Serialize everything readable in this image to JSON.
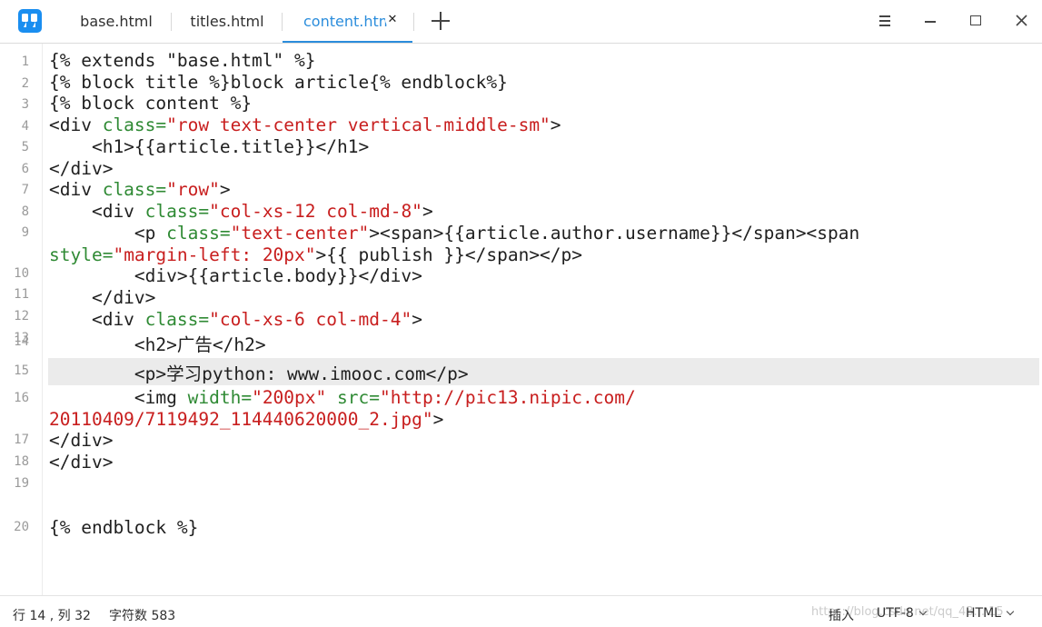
{
  "tabs": [
    {
      "label": "base.html",
      "active": false
    },
    {
      "label": "titles.html",
      "active": false
    },
    {
      "label": "content.html",
      "active": true
    }
  ],
  "icons": {
    "app": "quote-icon",
    "close_tab": "close-icon",
    "add_tab": "plus-icon",
    "menu": "hamburger-menu-icon",
    "minimize": "minimize-icon",
    "maximize": "maximize-icon",
    "close_window": "close-icon",
    "dropdown": "chevron-down-icon"
  },
  "colors": {
    "accent": "#2b8ddc",
    "line_highlight": "#ebebeb",
    "string": "#c81e1e",
    "attribute": "#2f8a34"
  },
  "editor": {
    "current_line": 14,
    "line_numbers": [
      "1",
      "2",
      "3",
      "4",
      "5",
      "6",
      "7",
      "8",
      "9",
      "10",
      "11",
      "12",
      "13",
      "14",
      "15",
      "16",
      "17",
      "18",
      "19",
      "20"
    ],
    "lines": [
      [
        {
          "t": "plain",
          "v": "{% extends \"base.html\" %}"
        }
      ],
      [
        {
          "t": "plain",
          "v": "{% block title %}block article{% endblock%}"
        }
      ],
      [
        {
          "t": "plain",
          "v": "{% block content %}"
        }
      ],
      [
        {
          "t": "tag",
          "v": "<div "
        },
        {
          "t": "attr",
          "v": "class="
        },
        {
          "t": "str",
          "v": "\"row text-center vertical-middle-sm\""
        },
        {
          "t": "tag",
          "v": ">"
        }
      ],
      [
        {
          "t": "plain",
          "v": "    <h1>{{article.title}}</h1>"
        }
      ],
      [
        {
          "t": "plain",
          "v": "</div>"
        }
      ],
      [
        {
          "t": "tag",
          "v": "<div "
        },
        {
          "t": "attr",
          "v": "class="
        },
        {
          "t": "str",
          "v": "\"row\""
        },
        {
          "t": "tag",
          "v": ">"
        }
      ],
      [
        {
          "t": "tag",
          "v": "    <div "
        },
        {
          "t": "attr",
          "v": "class="
        },
        {
          "t": "str",
          "v": "\"col-xs-12 col-md-8\""
        },
        {
          "t": "tag",
          "v": ">"
        }
      ],
      [
        {
          "t": "tag",
          "v": "        <p "
        },
        {
          "t": "attr",
          "v": "class="
        },
        {
          "t": "str",
          "v": "\"text-center\""
        },
        {
          "t": "tag",
          "v": "><span>{{article.author.username}}</span><span"
        }
      ],
      [
        {
          "t": "attr",
          "v": "style="
        },
        {
          "t": "str",
          "v": "\"margin-left: 20px\""
        },
        {
          "t": "tag",
          "v": ">{{ publish }}</span></p>"
        }
      ],
      [
        {
          "t": "plain",
          "v": "        <div>{{article.body}}</div>"
        }
      ],
      [
        {
          "t": "plain",
          "v": "    </div>"
        }
      ],
      [
        {
          "t": "tag",
          "v": "    <div "
        },
        {
          "t": "attr",
          "v": "class="
        },
        {
          "t": "str",
          "v": "\"col-xs-6 col-md-4\""
        },
        {
          "t": "tag",
          "v": ">"
        }
      ],
      [
        {
          "t": "plain",
          "v": "        <h2>广告</h2>"
        }
      ],
      [
        {
          "t": "plain",
          "v": "        <p>学习python: www.imooc.com</p>"
        }
      ],
      [
        {
          "t": "tag",
          "v": "        <img "
        },
        {
          "t": "attr",
          "v": "width="
        },
        {
          "t": "str",
          "v": "\"200px\""
        },
        {
          "t": "tag",
          "v": " "
        },
        {
          "t": "attr",
          "v": "src="
        },
        {
          "t": "str",
          "v": "\"http://pic13.nipic.com/"
        }
      ],
      [
        {
          "t": "str",
          "v": "20110409/7119492_114440620000_2.jpg\""
        },
        {
          "t": "tag",
          "v": ">"
        }
      ],
      [
        {
          "t": "plain",
          "v": "</div>"
        }
      ],
      [
        {
          "t": "plain",
          "v": "</div>"
        }
      ],
      [
        {
          "t": "plain",
          "v": "{% endblock %}"
        }
      ]
    ]
  },
  "status": {
    "position": "行 14 , 列 32",
    "char_count": "字符数 583",
    "mode": "插入",
    "encoding": "UTF-8",
    "language": "HTML",
    "watermark": "https://blog.csdn.net/qq_43... 15"
  }
}
